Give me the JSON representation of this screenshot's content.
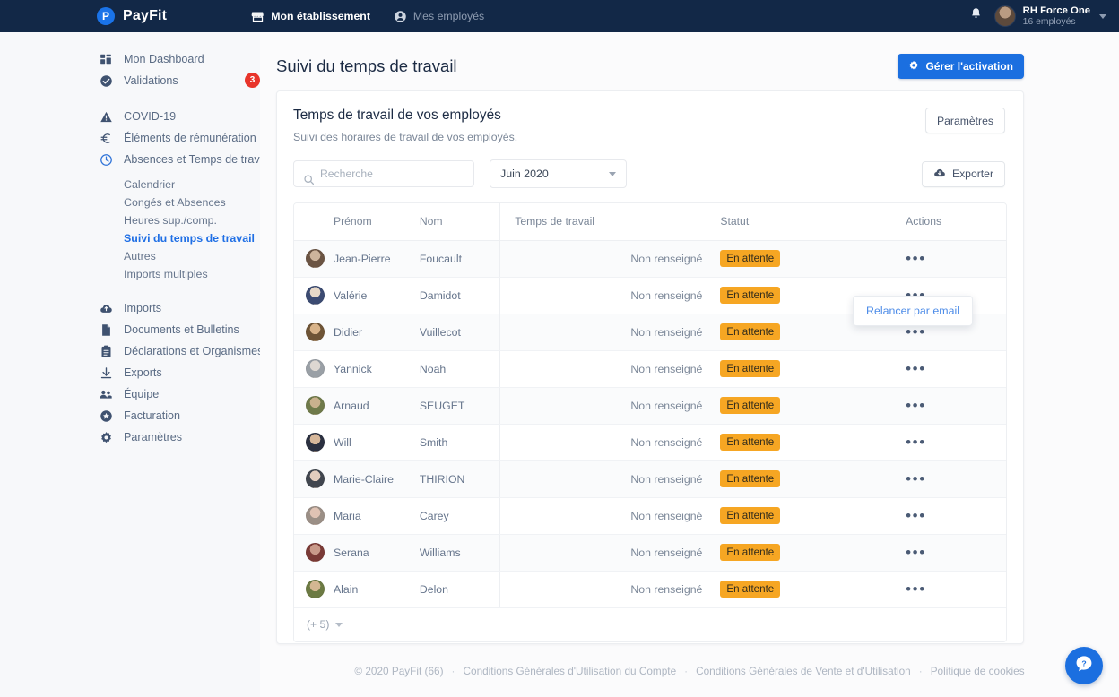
{
  "topbar": {
    "brand": "PayFit",
    "brand_initial": "P",
    "nav": [
      {
        "label": "Mon établissement",
        "icon": "store-icon",
        "active": true
      },
      {
        "label": "Mes employés",
        "icon": "user-circle-icon",
        "active": false
      }
    ],
    "account": {
      "name": "RH Force One",
      "sub": "16 employés"
    }
  },
  "sidebar": {
    "primary": [
      {
        "label": "Mon Dashboard",
        "icon": "dashboard-icon",
        "badge": ""
      },
      {
        "label": "Validations",
        "icon": "check-circle-icon",
        "badge": "3"
      }
    ],
    "secondary": [
      {
        "label": "COVID-19",
        "icon": "warning-icon"
      },
      {
        "label": "Éléments de rémunération",
        "icon": "euro-icon"
      },
      {
        "label": "Absences et Temps de travail",
        "icon": "clock-icon"
      }
    ],
    "sub_items": [
      {
        "label": "Calendrier",
        "active": false
      },
      {
        "label": "Congés et Absences",
        "active": false
      },
      {
        "label": "Heures sup./comp.",
        "active": false
      },
      {
        "label": "Suivi du temps de travail",
        "active": true
      },
      {
        "label": "Autres",
        "active": false
      },
      {
        "label": "Imports multiples",
        "active": false
      }
    ],
    "tertiary": [
      {
        "label": "Imports",
        "icon": "cloud-upload-icon"
      },
      {
        "label": "Documents et Bulletins",
        "icon": "document-icon"
      },
      {
        "label": "Déclarations et Organismes",
        "icon": "clipboard-icon"
      },
      {
        "label": "Exports",
        "icon": "download-icon"
      },
      {
        "label": "Équipe",
        "icon": "people-icon"
      },
      {
        "label": "Facturation",
        "icon": "star-circle-icon"
      },
      {
        "label": "Paramètres",
        "icon": "gear-icon"
      }
    ]
  },
  "page": {
    "title": "Suivi du temps de travail",
    "primary_button": "Gérer l'activation"
  },
  "card": {
    "title": "Temps de travail de vos employés",
    "subtitle": "Suivi des horaires de travail de vos employés.",
    "settings_button": "Paramètres",
    "export_button": "Exporter",
    "search_placeholder": "Recherche",
    "search_value": "",
    "period_value": "Juin 2020"
  },
  "table": {
    "headers": [
      "",
      "Prénom",
      "Nom",
      "Temps de travail",
      "Statut",
      "Actions"
    ],
    "rows": [
      {
        "first": "Jean-Pierre",
        "last": "Foucault",
        "time": "Non renseigné",
        "status": "En attente",
        "actions": "•••"
      },
      {
        "first": "Valérie",
        "last": "Damidot",
        "time": "Non renseigné",
        "status": "En attente",
        "actions": "•••"
      },
      {
        "first": "Didier",
        "last": "Vuillecot",
        "time": "Non renseigné",
        "status": "En attente",
        "actions": "•••"
      },
      {
        "first": "Yannick",
        "last": "Noah",
        "time": "Non renseigné",
        "status": "En attente",
        "actions": "•••"
      },
      {
        "first": "Arnaud",
        "last": "SEUGET",
        "time": "Non renseigné",
        "status": "En attente",
        "actions": "•••"
      },
      {
        "first": "Will",
        "last": "Smith",
        "time": "Non renseigné",
        "status": "En attente",
        "actions": "•••"
      },
      {
        "first": "Marie-Claire",
        "last": "THIRION",
        "time": "Non renseigné",
        "status": "En attente",
        "actions": "•••"
      },
      {
        "first": "Maria",
        "last": "Carey",
        "time": "Non renseigné",
        "status": "En attente",
        "actions": "•••"
      },
      {
        "first": "Serana",
        "last": "Williams",
        "time": "Non renseigné",
        "status": "En attente",
        "actions": "•••"
      },
      {
        "first": "Alain",
        "last": "Delon",
        "time": "Non renseigné",
        "status": "En attente",
        "actions": "•••"
      }
    ],
    "more_label": "(+ 5)"
  },
  "popup": {
    "label": "Relancer par email"
  },
  "footer": {
    "copyright": "© 2020 PayFit (66)",
    "links": [
      "Conditions Générales d'Utilisation du Compte",
      "Conditions Générales de Vente et d'Utilisation",
      "Politique de cookies"
    ],
    "separator": "·"
  },
  "help": {
    "icon": "question-help-icon"
  },
  "colors": {
    "topbar": "#122847",
    "accent": "#1b6fe0",
    "badge_amber": "#f6a623",
    "badge_red": "#e8342a",
    "sidebar_bg": "#f7f8fa"
  }
}
